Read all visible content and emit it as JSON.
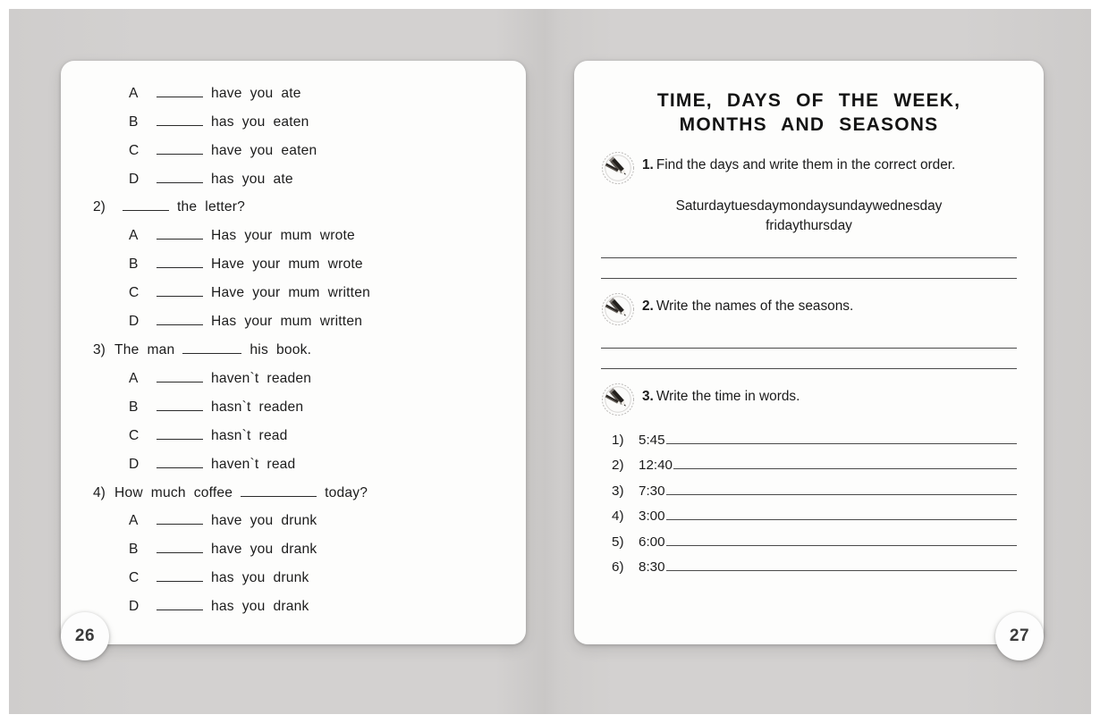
{
  "book": {
    "left_page_number": "26",
    "right_page_number": "27"
  },
  "left_page": {
    "questions": [
      {
        "number": "",
        "prompt": "",
        "options": [
          {
            "letter": "A",
            "words": [
              "have",
              "you",
              "ate"
            ]
          },
          {
            "letter": "B",
            "words": [
              "has",
              "you",
              "eaten"
            ]
          },
          {
            "letter": "C",
            "words": [
              "have",
              "you",
              "eaten"
            ]
          },
          {
            "letter": "D",
            "words": [
              "has",
              "you",
              "ate"
            ]
          }
        ]
      },
      {
        "number": "2)",
        "prompt_after_blank": [
          "the",
          "letter?"
        ],
        "options": [
          {
            "letter": "A",
            "words": [
              "Has",
              "your",
              "mum",
              "wrote"
            ]
          },
          {
            "letter": "B",
            "words": [
              "Have",
              "your",
              "mum",
              "wrote"
            ]
          },
          {
            "letter": "C",
            "words": [
              "Have",
              "your",
              "mum",
              "written"
            ]
          },
          {
            "letter": "D",
            "words": [
              "Has",
              "your",
              "mum",
              "written"
            ]
          }
        ]
      },
      {
        "number": "3)",
        "prompt_before_blank": [
          "The",
          "man"
        ],
        "prompt_after_blank": [
          "his",
          "book."
        ],
        "options": [
          {
            "letter": "A",
            "words": [
              "haven`t",
              "readen"
            ]
          },
          {
            "letter": "B",
            "words": [
              "hasn`t",
              "readen"
            ]
          },
          {
            "letter": "C",
            "words": [
              "hasn`t",
              "read"
            ]
          },
          {
            "letter": "D",
            "words": [
              "haven`t",
              "read"
            ]
          }
        ]
      },
      {
        "number": "4)",
        "prompt_before_blank": [
          "How",
          "much",
          "coffee"
        ],
        "prompt_after_blank": [
          "today?"
        ],
        "options": [
          {
            "letter": "A",
            "words": [
              "have",
              "you",
              "drunk"
            ]
          },
          {
            "letter": "B",
            "words": [
              "have",
              "you",
              "drank"
            ]
          },
          {
            "letter": "C",
            "words": [
              "has",
              "you",
              "drunk"
            ]
          },
          {
            "letter": "D",
            "words": [
              "has",
              "you",
              "drank"
            ]
          }
        ]
      }
    ]
  },
  "right_page": {
    "title_line_1": "TIME,  DAYS  OF  THE  WEEK,",
    "title_line_2": "MONTHS  AND  SEASONS",
    "tasks": [
      {
        "number": "1.",
        "text": "Find  the  days  and  write  them  in  the  correct  order.",
        "icon": "pencil-badge-icon"
      },
      {
        "number": "2.",
        "text": "Write   the   names   of   the   seasons.",
        "icon": "pencil-badge-icon"
      },
      {
        "number": "3.",
        "text": "Write   the   time   in   words.",
        "icon": "pencil-badge-icon"
      }
    ],
    "scramble_line_1": "Saturdaytuesdaymondaysundaywednesday",
    "scramble_line_2": "fridaythursday",
    "time_items": [
      {
        "index": "1)",
        "time": "5:45"
      },
      {
        "index": "2)",
        "time": "12:40"
      },
      {
        "index": "3)",
        "time": "7:30"
      },
      {
        "index": "4)",
        "time": "3:00"
      },
      {
        "index": "5)",
        "time": "6:00"
      },
      {
        "index": "6)",
        "time": "8:30"
      }
    ]
  },
  "colors": {
    "backdrop": "#d2d0cf",
    "page": "#fdfdfc",
    "text": "#1b1b1b",
    "rule": "#4a4a4a"
  }
}
